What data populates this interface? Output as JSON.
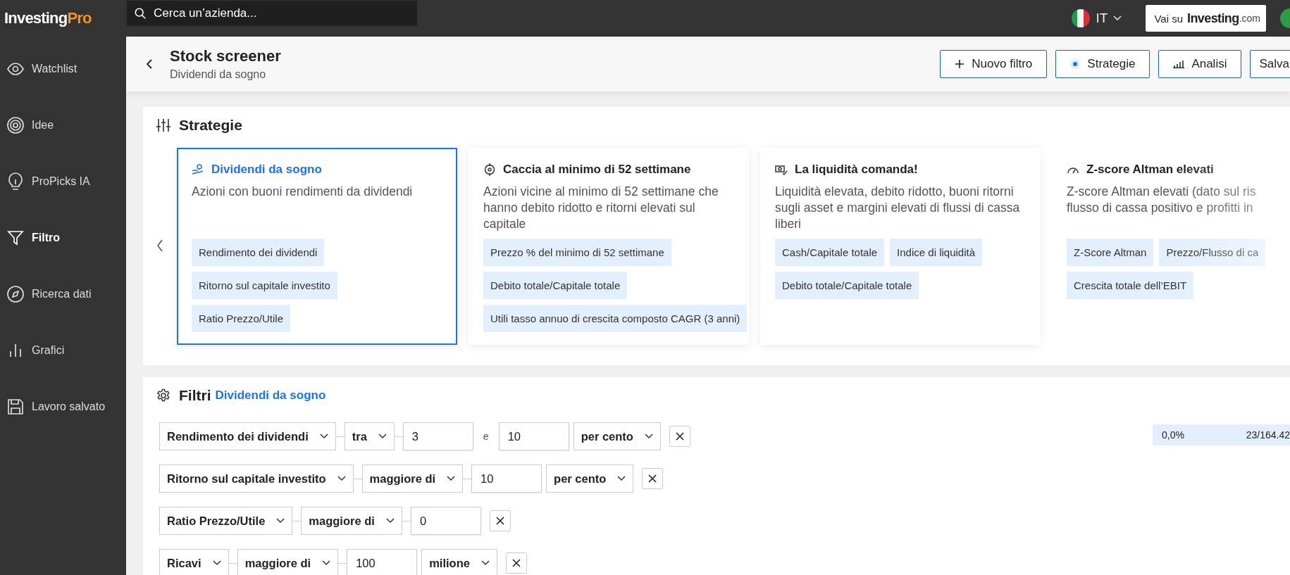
{
  "topbar": {
    "logo": {
      "main": "Investing",
      "accent": "Pro"
    },
    "search": {
      "placeholder": "Cerca un’azienda..."
    },
    "language": "IT",
    "site_link": {
      "prefix": "Vai su",
      "brand": "Investing",
      "suffix": ".com"
    }
  },
  "sidebar": {
    "items": [
      {
        "label": "Watchlist",
        "selected": false
      },
      {
        "label": "Idee",
        "selected": false
      },
      {
        "label": "ProPicks IA",
        "selected": false
      },
      {
        "label": "Filtro",
        "selected": true
      },
      {
        "label": "Ricerca dati",
        "selected": false
      },
      {
        "label": "Grafici",
        "selected": false
      },
      {
        "label": "Lavoro salvato",
        "selected": false
      }
    ]
  },
  "header": {
    "title": "Stock screener",
    "subtitle": "Dividendi da sogno",
    "buttons": [
      {
        "label": "Nuovo filtro",
        "kind": "plus"
      },
      {
        "label": "Strategie",
        "kind": "radio",
        "checked": true
      },
      {
        "label": "Analisi",
        "kind": "chart"
      },
      {
        "label": "Salva",
        "kind": "plain"
      }
    ]
  },
  "strategies": {
    "title": "Strategie",
    "cards": [
      {
        "title": "Dividendi da sogno",
        "selected": true,
        "description": "Azioni con buoni rendimenti da dividendi",
        "chips": [
          "Rendimento dei dividendi",
          "Ritorno sul capitale investito",
          "Ratio Prezzo/Utile"
        ]
      },
      {
        "title": "Caccia al minimo di 52 settimane",
        "selected": false,
        "description": "Azioni vicine al minimo di 52 settimane che hanno debito ridotto e ritorni elevati sul capitale",
        "chips": [
          "Prezzo % del minimo di 52 settimane",
          "Debito totale/Capitale totale",
          "Utili tasso annuo di crescita composto CAGR (3 anni)"
        ]
      },
      {
        "title": "La liquidità comanda!",
        "selected": false,
        "description": "Liquidità elevata, debito ridotto, buoni ritorni sugli asset e margini elevati di flussi di cassa liberi",
        "chips": [
          "Cash/Capitale totale",
          "Indice di liquidità",
          "Debito totale/Capitale totale"
        ]
      },
      {
        "title": "Z-score Altman elevati",
        "selected": false,
        "description": "Z-score Altman elevati (dato sul ris\nflusso di cassa positivo e profitti in",
        "chips": [
          "Z-Score Altman",
          "Prezzo/Flusso di ca",
          "Crescita totale dell’EBIT"
        ]
      }
    ]
  },
  "filters": {
    "title": "Filtri",
    "strategy": "Dividendi da sogno",
    "result": {
      "share": "0,0%",
      "count": "23/164.42"
    },
    "rows": [
      {
        "field": "Rendimento dei dividendi",
        "operator": "tra",
        "values": [
          "3",
          "10"
        ],
        "joiner": "e",
        "unit": "per cento"
      },
      {
        "field": "Ritorno sul capitale investito",
        "operator": "maggiore di",
        "values": [
          "10"
        ],
        "unit": "per cento"
      },
      {
        "field": "Ratio Prezzo/Utile",
        "operator": "maggiore di",
        "values": [
          "0"
        ]
      },
      {
        "field": "Ricavi",
        "operator": "maggiore di",
        "values": [
          "100"
        ],
        "unit": "milione"
      }
    ]
  }
}
